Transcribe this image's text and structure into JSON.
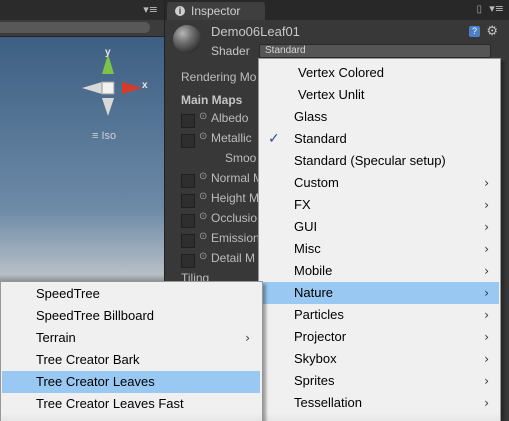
{
  "scene": {
    "menu_icon": "▾≡",
    "gizmo_labels": {
      "y": "y",
      "x": "x"
    },
    "iso_label": "Iso"
  },
  "inspector": {
    "tab_label": "Inspector",
    "tab_icon_glyph": "i",
    "lock_icon": "🔒",
    "tab_menu_icon": "▾≡",
    "material_name": "Demo06Leaf01",
    "help_icon": "?",
    "gear_icon": "⚙",
    "shader_label": "Shader",
    "shader_value": "Standard",
    "rendering_mode_label": "Rendering Mo",
    "main_maps_label": "Main Maps",
    "properties": [
      {
        "label": "Albedo",
        "dot": "⊙",
        "check": true
      },
      {
        "label": "Metallic",
        "dot": "⊙",
        "check": true
      },
      {
        "label": "Smoo",
        "dot": "",
        "check": false
      },
      {
        "label": "Normal M",
        "dot": "⊙",
        "check": true
      },
      {
        "label": "Height M",
        "dot": "⊙",
        "check": true
      },
      {
        "label": "Occlusio",
        "dot": "⊙",
        "check": true
      },
      {
        "label": "Emission",
        "dot": "⊙",
        "check": true
      },
      {
        "label": "Detail M",
        "dot": "⊙",
        "check": true
      }
    ],
    "tiling_label": "Tiling"
  },
  "shader_menu": {
    "items": [
      {
        "label": "Vertex Colored",
        "has_submenu": false,
        "checked": false,
        "highlighted": false
      },
      {
        "label": "Vertex Unlit",
        "has_submenu": false,
        "checked": false,
        "highlighted": false
      },
      {
        "label": "Glass",
        "has_submenu": false,
        "checked": false,
        "highlighted": false
      },
      {
        "label": "Standard",
        "has_submenu": false,
        "checked": true,
        "highlighted": false
      },
      {
        "label": "Standard (Specular setup)",
        "has_submenu": false,
        "checked": false,
        "highlighted": false
      },
      {
        "label": "Custom",
        "has_submenu": true,
        "checked": false,
        "highlighted": false
      },
      {
        "label": "FX",
        "has_submenu": true,
        "checked": false,
        "highlighted": false
      },
      {
        "label": "GUI",
        "has_submenu": true,
        "checked": false,
        "highlighted": false
      },
      {
        "label": "Misc",
        "has_submenu": true,
        "checked": false,
        "highlighted": false
      },
      {
        "label": "Mobile",
        "has_submenu": true,
        "checked": false,
        "highlighted": false
      },
      {
        "label": "Nature",
        "has_submenu": true,
        "checked": false,
        "highlighted": true
      },
      {
        "label": "Particles",
        "has_submenu": true,
        "checked": false,
        "highlighted": false
      },
      {
        "label": "Projector",
        "has_submenu": true,
        "checked": false,
        "highlighted": false
      },
      {
        "label": "Skybox",
        "has_submenu": true,
        "checked": false,
        "highlighted": false
      },
      {
        "label": "Sprites",
        "has_submenu": true,
        "checked": false,
        "highlighted": false
      },
      {
        "label": "Tessellation",
        "has_submenu": true,
        "checked": false,
        "highlighted": false
      }
    ],
    "check_glyph": "✓",
    "arrow_glyph": "›"
  },
  "nature_submenu": {
    "items": [
      {
        "label": "SpeedTree",
        "has_submenu": false,
        "highlighted": false
      },
      {
        "label": "SpeedTree Billboard",
        "has_submenu": false,
        "highlighted": false
      },
      {
        "label": "Terrain",
        "has_submenu": true,
        "highlighted": false
      },
      {
        "label": "Tree Creator Bark",
        "has_submenu": false,
        "highlighted": false
      },
      {
        "label": "Tree Creator Leaves",
        "has_submenu": false,
        "highlighted": true
      },
      {
        "label": "Tree Creator Leaves Fast",
        "has_submenu": false,
        "highlighted": false
      }
    ]
  },
  "colors": {
    "menu_highlight": "#99c9f3",
    "inspector_bg": "#383838",
    "menu_bg": "#f0f0f0"
  }
}
